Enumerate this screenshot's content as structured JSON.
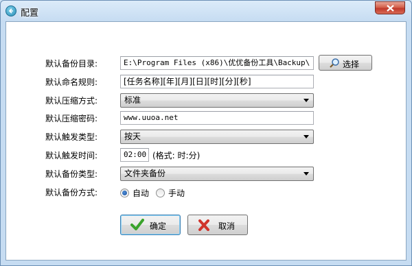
{
  "window": {
    "title": "配置"
  },
  "fields": {
    "backup_dir": {
      "label": "默认备份目录:",
      "value": "E:\\Program Files (x86)\\优优备份工具\\Backup\\"
    },
    "naming_rule": {
      "label": "默认命名规则:",
      "value": "[任务名称][年][月][日][时][分][秒]"
    },
    "compress_mode": {
      "label": "默认压缩方式:",
      "value": "标准"
    },
    "compress_password": {
      "label": "默认压缩密码:",
      "value": "www.uuoa.net"
    },
    "trigger_type": {
      "label": "默认触发类型:",
      "value": "按天"
    },
    "trigger_time": {
      "label": "默认触发时间:",
      "value": "02:00",
      "hint": "(格式: 时:分)"
    },
    "backup_type": {
      "label": "默认备份类型:",
      "value": "文件夹备份"
    },
    "backup_mode": {
      "label": "默认备份方式:",
      "options": [
        "自动",
        "手动"
      ],
      "selected": "自动"
    }
  },
  "buttons": {
    "browse": {
      "label": "选择",
      "icon": "magnifier-icon"
    },
    "ok": {
      "label": "确定",
      "icon": "checkmark-icon"
    },
    "cancel": {
      "label": "取消",
      "icon": "red-x-icon"
    }
  },
  "colors": {
    "ok_check": "#3aa32c",
    "cancel_x": "#d0342c",
    "window_frame": "#c6dcf2",
    "close_button": "#c0392b"
  }
}
